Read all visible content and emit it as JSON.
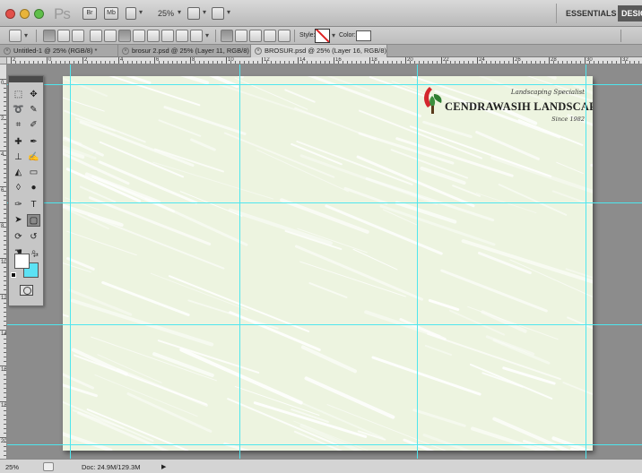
{
  "app": {
    "logo": "Ps",
    "bridge_button": "Br",
    "minibridge_button": "Mb",
    "zoom_level": "25%"
  },
  "workspace": {
    "essentials": "ESSENTIALS",
    "design": "DESIGN"
  },
  "options": {
    "style_label": "Style:",
    "color_label": "Color:"
  },
  "tabs": [
    {
      "label": "Untitled-1 @ 25% (RGB/8) *"
    },
    {
      "label": "brosur 2.psd @ 25% (Layer 11, RGB/8)"
    },
    {
      "label": "BROSUR.psd @ 25% (Layer 16, RGB/8) *"
    }
  ],
  "ruler": {
    "top_labels": [
      "2",
      "0",
      "2",
      "4",
      "6",
      "8",
      "10",
      "12",
      "14",
      "16",
      "18",
      "20",
      "22",
      "24",
      "26",
      "28",
      "30",
      "32"
    ],
    "left_labels": [
      "0",
      "2",
      "4",
      "6",
      "8",
      "10",
      "12",
      "14",
      "16",
      "18",
      "20"
    ]
  },
  "document": {
    "logo_tagline": "Landscaping Specialist",
    "logo_name": "CENDRAWASIH LANDSCAPE",
    "logo_since": "Since 1982"
  },
  "status": {
    "zoom": "25%",
    "doc_size": "Doc: 24.9M/129.3M"
  },
  "colors": {
    "guide": "#4fe6ee",
    "paper": "#edf4e0",
    "foreground": "#ffffff",
    "background": "#5ce2f4",
    "logo_red": "#d3262d",
    "logo_green": "#2f7d32"
  }
}
